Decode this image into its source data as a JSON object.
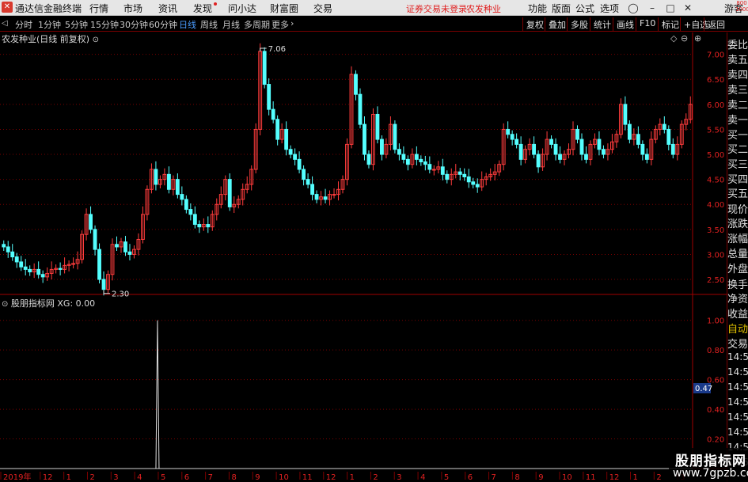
{
  "app": {
    "name": "通达信金融终端",
    "menus": [
      "行情",
      "市场",
      "资讯",
      "发现",
      "问小达",
      "财富圈",
      "交易"
    ],
    "notice": "证券交易未登录",
    "stock_name": "农发种业",
    "right_menus": [
      "功能",
      "版面",
      "公式",
      "选项"
    ],
    "guest": "游客"
  },
  "toolbar": {
    "periods": [
      "分时",
      "1分钟",
      "5分钟",
      "15分钟",
      "30分钟",
      "60分钟",
      "日线",
      "周线",
      "月线",
      "多周期",
      "更多"
    ],
    "active_period": "日线",
    "right_buttons": [
      "复权",
      "叠加",
      "多股",
      "统计",
      "画线",
      "F10",
      "标记",
      "+自选",
      "返回"
    ]
  },
  "main_chart": {
    "title": "农发种业(日线 前复权)",
    "high_label": "7.06",
    "low_label": "2.30"
  },
  "indicator": {
    "title": "股朋指标网 XG: 0.00",
    "current_value": "0.47"
  },
  "right_panel": {
    "top_code": "800 1000",
    "items": [
      "委比",
      "卖五",
      "卖四",
      "卖三",
      "卖二",
      "卖一",
      "买一",
      "买二",
      "买三",
      "买四",
      "买五",
      "现价",
      "涨跌",
      "涨幅",
      "总量",
      "外盘",
      "换手",
      "净资",
      "收益",
      "自动",
      "交易",
      "14:56",
      "14:56",
      "14:56",
      "14:56",
      "14:56",
      "14:56",
      "14:56",
      "14:56"
    ]
  },
  "watermark": {
    "line1": "股朋指标网",
    "line2": "www.7gpzb.com"
  },
  "colors": {
    "up": "#ff3c3c",
    "down": "#54ffff",
    "grid": "#7a0000",
    "axis_text": "#e02020",
    "active_tab": "#4a9cff"
  },
  "chart_data": [
    {
      "type": "candlestick",
      "title": "农发种业(日线 前复权)",
      "y_ticks": [
        2.5,
        3.0,
        3.5,
        4.0,
        4.5,
        5.0,
        5.5,
        6.0,
        6.5,
        7.0
      ],
      "ylim": [
        2.2,
        7.2
      ],
      "x_ticks": [
        "2019年",
        "12",
        "1",
        "2",
        "3",
        "4",
        "5",
        "6",
        "7",
        "8",
        "9",
        "10",
        "11",
        "12",
        "1",
        "2",
        "3",
        "4",
        "5",
        "6",
        "7",
        "8",
        "9",
        "10",
        "11",
        "12",
        "1",
        "2",
        "3"
      ],
      "close": [
        3.15,
        3.05,
        2.95,
        2.85,
        2.75,
        2.7,
        2.65,
        2.7,
        2.6,
        2.55,
        2.62,
        2.7,
        2.72,
        2.7,
        2.78,
        2.8,
        2.82,
        2.9,
        3.4,
        3.8,
        3.5,
        3.1,
        2.5,
        2.3,
        2.6,
        3.2,
        3.15,
        3.25,
        3.05,
        3.0,
        3.1,
        3.3,
        3.8,
        4.3,
        4.7,
        4.4,
        4.5,
        4.6,
        4.3,
        4.5,
        4.2,
        4.1,
        3.9,
        3.8,
        3.6,
        3.55,
        3.6,
        3.55,
        3.8,
        4.0,
        4.2,
        4.5,
        3.95,
        4.0,
        4.1,
        4.3,
        4.4,
        4.7,
        5.5,
        7.06,
        6.4,
        5.9,
        5.7,
        5.3,
        5.5,
        5.1,
        5.0,
        4.9,
        4.7,
        4.5,
        4.4,
        4.2,
        4.1,
        4.15,
        4.1,
        4.2,
        4.2,
        4.3,
        4.5,
        5.2,
        6.6,
        6.2,
        5.6,
        5.0,
        4.8,
        5.8,
        5.3,
        5.0,
        5.2,
        5.6,
        5.1,
        5.0,
        4.9,
        4.8,
        5.0,
        4.9,
        4.85,
        4.8,
        4.7,
        4.7,
        4.75,
        4.6,
        4.5,
        4.6,
        4.65,
        4.6,
        4.55,
        4.45,
        4.4,
        4.35,
        4.5,
        4.55,
        4.6,
        4.65,
        4.8,
        5.5,
        5.4,
        5.3,
        5.2,
        4.9,
        5.1,
        5.2,
        5.0,
        4.75,
        5.0,
        5.3,
        5.2,
        5.0,
        4.9,
        5.0,
        5.1,
        5.5,
        5.3,
        5.0,
        4.9,
        5.2,
        5.3,
        5.1,
        5.0,
        5.1,
        5.25,
        5.4,
        6.0,
        5.6,
        5.3,
        5.4,
        5.2,
        5.0,
        4.9,
        5.3,
        5.5,
        5.6,
        5.5,
        5.2,
        5.0,
        5.2,
        5.6,
        5.7,
        6.0
      ]
    },
    {
      "type": "line",
      "title": "股朋指标网 XG: 0.00",
      "series": [
        {
          "name": "XG",
          "spike_at_label": "5",
          "peak": 1.0
        }
      ],
      "y_ticks": [
        0.2,
        0.4,
        0.6,
        0.8,
        1.0
      ],
      "ylim": [
        0.0,
        1.1
      ]
    }
  ]
}
